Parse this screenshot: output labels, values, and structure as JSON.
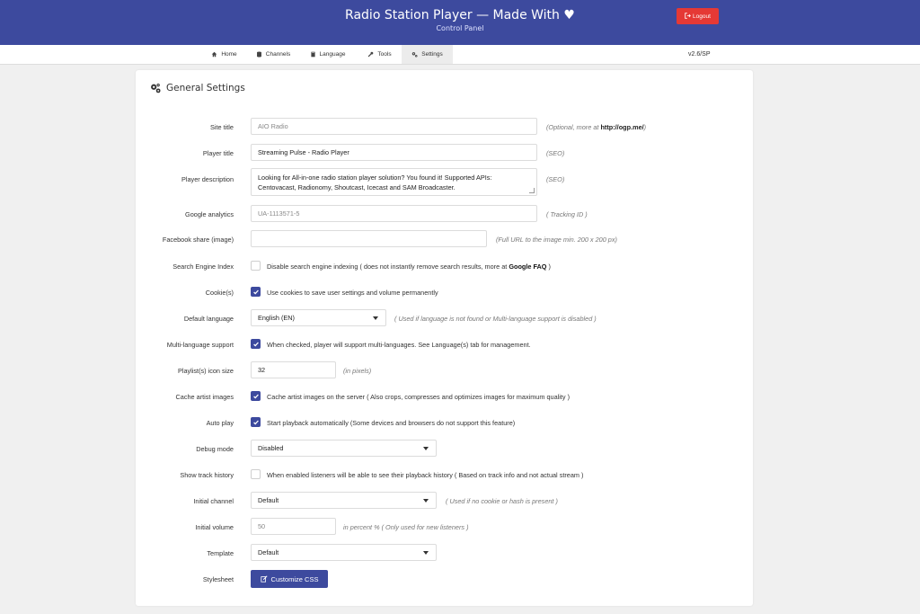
{
  "header": {
    "title": "Radio Station Player — Made With ♥",
    "subtitle": "Control Panel",
    "logout_label": "Logout"
  },
  "nav": {
    "items": [
      {
        "label": "Home",
        "icon": "home-icon"
      },
      {
        "label": "Channels",
        "icon": "database-icon"
      },
      {
        "label": "Language",
        "icon": "book-icon"
      },
      {
        "label": "Tools",
        "icon": "wrench-icon"
      },
      {
        "label": "Settings",
        "icon": "cogs-icon",
        "active": true
      }
    ],
    "version": "v2.6/SP"
  },
  "settings": {
    "title": "General Settings",
    "site_title": {
      "label": "Site title",
      "placeholder": "AIO Radio",
      "hint_prefix": "(Optional, more at ",
      "hint_link": "http://ogp.me/",
      "hint_suffix": ")"
    },
    "player_title": {
      "label": "Player title",
      "value": "Streaming Pulse - Radio Player",
      "hint": "(SEO)"
    },
    "player_description": {
      "label": "Player description",
      "value": "Looking for All-in-one radio station player solution? You found it! Supported APIs: Centovacast, Radionomy, Shoutcast, Icecast and SAM Broadcaster.",
      "hint": "(SEO)"
    },
    "google_analytics": {
      "label": "Google analytics",
      "placeholder": "UA-1113571-5",
      "hint": "( Tracking ID )"
    },
    "facebook_share": {
      "label": "Facebook share (image)",
      "value": "",
      "hint": "(Full URL to the image min. 200 x 200 px)"
    },
    "search_engine_index": {
      "label": "Search Engine Index",
      "checked": false,
      "text": "Disable search engine indexing ( does not instantly remove search results, more at ",
      "link": "Google FAQ",
      "text_suffix": " )"
    },
    "cookies": {
      "label": "Cookie(s)",
      "checked": true,
      "text": "Use cookies to save user settings and volume permanently"
    },
    "default_language": {
      "label": "Default language",
      "value": "English (EN)",
      "hint": "( Used if language is not found or Multi-language support is disabled )"
    },
    "multi_language": {
      "label": "Multi-language support",
      "checked": true,
      "text": "When checked, player will support multi-languages. See Language(s) tab for management."
    },
    "playlist_icon_size": {
      "label": "Playlist(s) icon size",
      "value": "32",
      "hint": "(in pixels)"
    },
    "cache_artist_images": {
      "label": "Cache artist images",
      "checked": true,
      "text": "Cache artist images on the server ( Also crops, compresses and optimizes images for maximum quality )"
    },
    "auto_play": {
      "label": "Auto play",
      "checked": true,
      "text": "Start playback automatically (Some devices and browsers do not support this feature)"
    },
    "debug_mode": {
      "label": "Debug mode",
      "value": "Disabled"
    },
    "show_track_history": {
      "label": "Show track history",
      "checked": false,
      "text": "When enabled listeners will be able to see their playback history ( Based on track info and not actual stream )"
    },
    "initial_channel": {
      "label": "Initial channel",
      "value": "Default",
      "hint": "( Used if no cookie or hash is present )"
    },
    "initial_volume": {
      "label": "Initial volume",
      "placeholder": "50",
      "hint": "in percent % ( Only used for new listeners )"
    },
    "template": {
      "label": "Template",
      "value": "Default"
    },
    "stylesheet": {
      "label": "Stylesheet",
      "button_label": "Customize CSS"
    }
  }
}
